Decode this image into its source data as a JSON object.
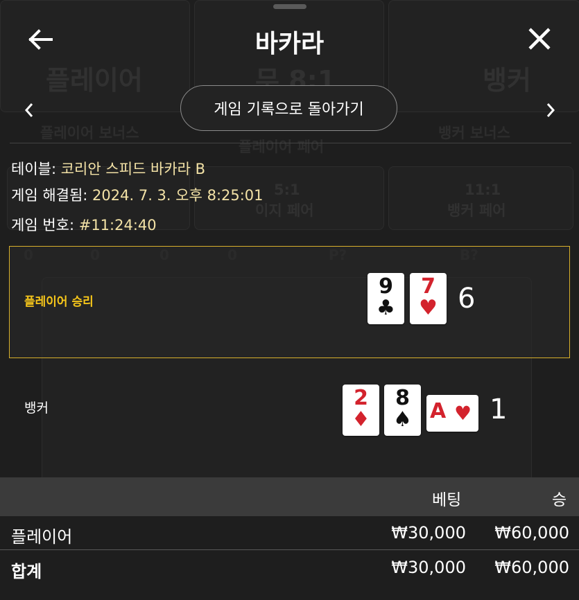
{
  "header": {
    "title": "바카라"
  },
  "nav": {
    "history_button_label": "게임 기록으로 돌아가기"
  },
  "info": {
    "table_label": "테이블:",
    "table_value": "코리안 스피드 바카라 B",
    "resolved_label": "게임 해결됨:",
    "resolved_value": "2024. 7. 3. 오후 8:25:01",
    "game_no_label": "게임 번호:",
    "game_no_value": "#11:24:40"
  },
  "hands": {
    "player": {
      "label": "플레이어 승리",
      "score": "6",
      "cards": [
        {
          "rank": "9",
          "suit": "♣",
          "color": "#111111"
        },
        {
          "rank": "7",
          "suit": "♥",
          "color": "#d3232d"
        }
      ]
    },
    "banker": {
      "label": "뱅커",
      "score": "1",
      "cards": [
        {
          "rank": "2",
          "suit": "♦",
          "color": "#d3232d"
        },
        {
          "rank": "8",
          "suit": "♠",
          "color": "#111111"
        },
        {
          "rank": "A",
          "suit": "♥",
          "color": "#d3232d"
        }
      ]
    }
  },
  "bets_table": {
    "headers": {
      "bet": "베팅",
      "win": "승"
    },
    "rows": [
      {
        "name": "플레이어",
        "bet": "₩30,000",
        "win": "₩60,000"
      }
    ],
    "total": {
      "name": "합계",
      "bet": "₩30,000",
      "win": "₩60,000"
    }
  },
  "background_board": {
    "labels": [
      "플레이어",
      "무 8:1",
      "뱅커",
      "플레이어 보너스",
      "플레이어 페어",
      "뱅커 보너스",
      "5:1",
      "이지 페어",
      "11:1",
      "뱅커 페어",
      "P?",
      "B?"
    ],
    "chip_counts": [
      "0",
      "0",
      "0",
      "0"
    ]
  },
  "colors": {
    "accent_gold": "#d9b12c",
    "win_label": "#f6c61a",
    "info_value": "#f3e2a6",
    "background": "#1e1e1e"
  },
  "icons": {
    "back": "arrow-left-icon",
    "close": "close-icon",
    "prev": "chevron-left-icon",
    "next": "chevron-right-icon"
  }
}
